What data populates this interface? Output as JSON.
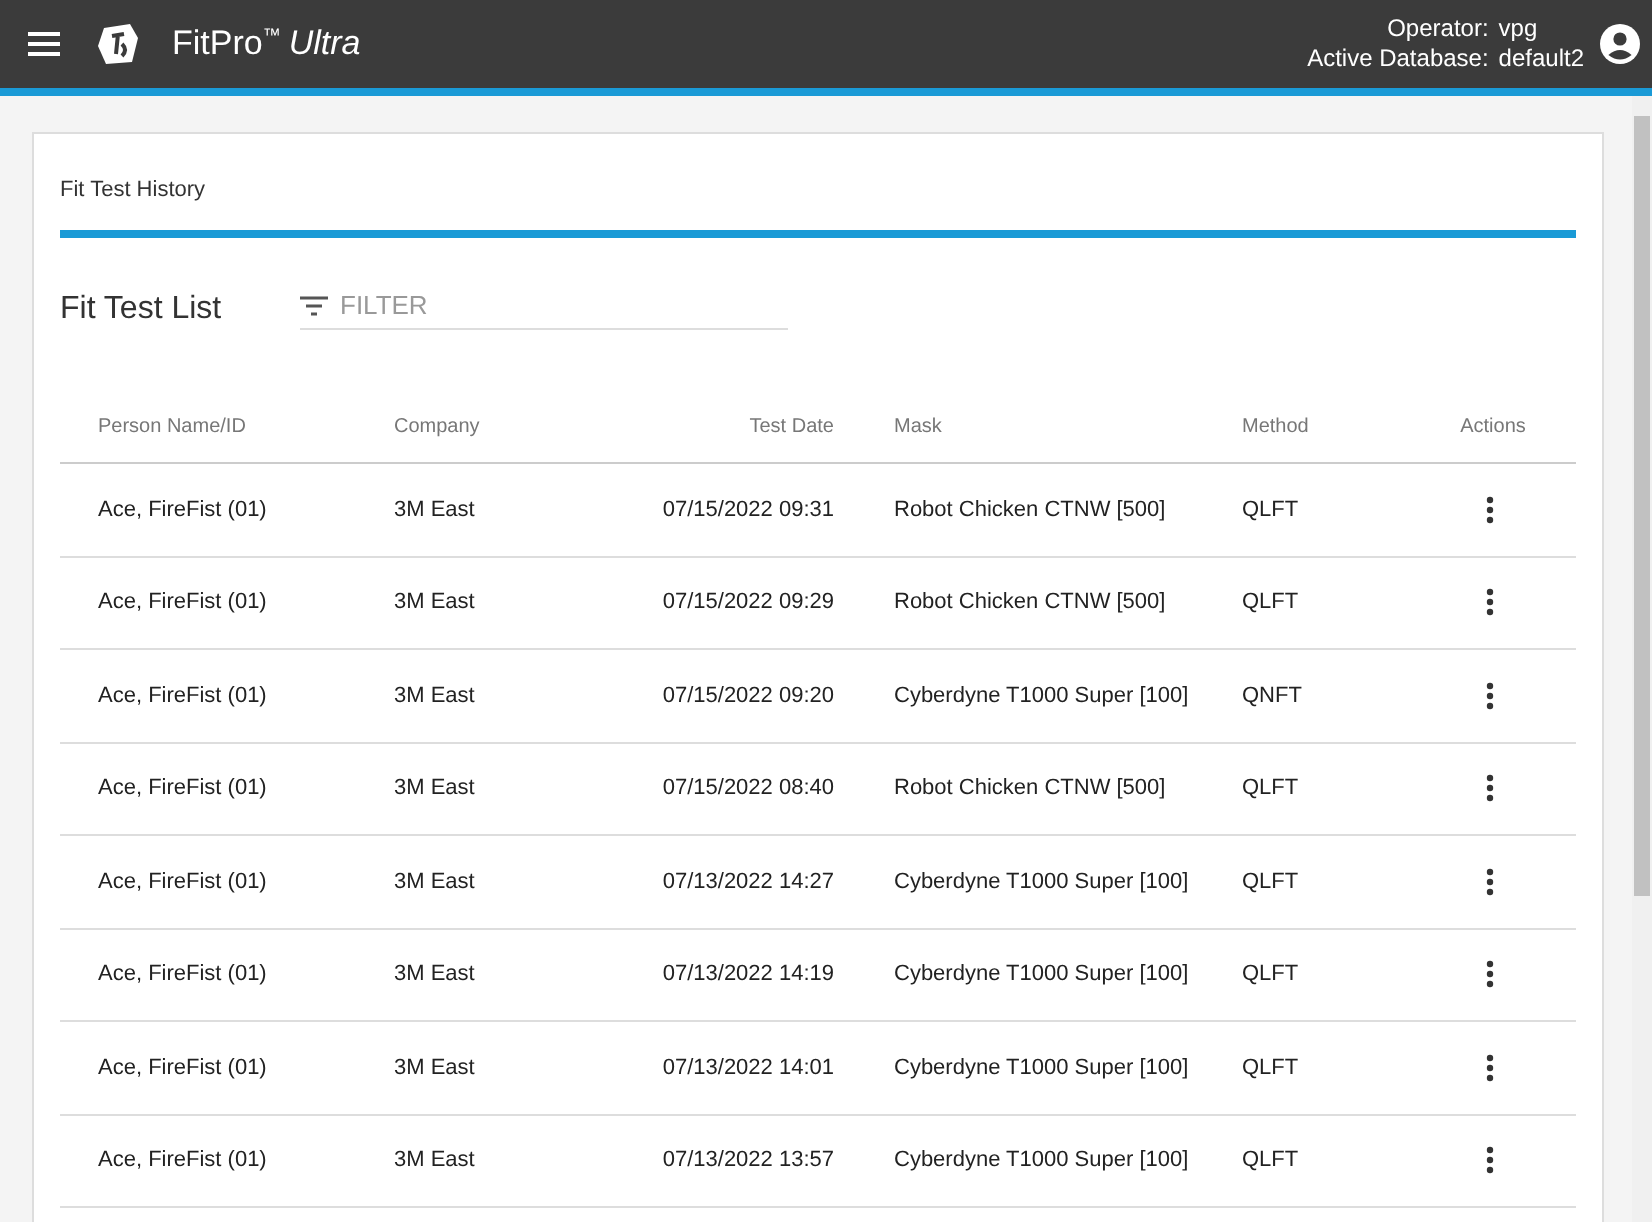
{
  "app_bar": {
    "product": "FitPro",
    "trademark": "™",
    "edition": "Ultra",
    "operator_label": "Operator:",
    "operator": "vpg",
    "database_label": "Active Database:",
    "database": "default2"
  },
  "tabs": [
    {
      "label": "Fit Test History",
      "selected": true
    }
  ],
  "list": {
    "title": "Fit Test List",
    "filter": {
      "placeholder": "FILTER"
    }
  },
  "table": {
    "columns": [
      "Person Name/ID",
      "Company",
      "Test Date",
      "Mask",
      "Method",
      "Actions"
    ],
    "rows": [
      {
        "person": "Ace, FireFist (01)",
        "company": "3M East",
        "date": "07/15/2022 09:31",
        "mask": "Robot Chicken CTNW [500]",
        "method": "QLFT"
      },
      {
        "person": "Ace, FireFist (01)",
        "company": "3M East",
        "date": "07/15/2022 09:29",
        "mask": "Robot Chicken CTNW [500]",
        "method": "QLFT"
      },
      {
        "person": "Ace, FireFist (01)",
        "company": "3M East",
        "date": "07/15/2022 09:20",
        "mask": "Cyberdyne T1000 Super [100]",
        "method": "QNFT"
      },
      {
        "person": "Ace, FireFist (01)",
        "company": "3M East",
        "date": "07/15/2022 08:40",
        "mask": "Robot Chicken CTNW [500]",
        "method": "QLFT"
      },
      {
        "person": "Ace, FireFist (01)",
        "company": "3M East",
        "date": "07/13/2022 14:27",
        "mask": "Cyberdyne T1000 Super [100]",
        "method": "QLFT"
      },
      {
        "person": "Ace, FireFist (01)",
        "company": "3M East",
        "date": "07/13/2022 14:19",
        "mask": "Cyberdyne T1000 Super [100]",
        "method": "QLFT"
      },
      {
        "person": "Ace, FireFist (01)",
        "company": "3M East",
        "date": "07/13/2022 14:01",
        "mask": "Cyberdyne T1000 Super [100]",
        "method": "QLFT"
      },
      {
        "person": "Ace, FireFist (01)",
        "company": "3M East",
        "date": "07/13/2022 13:57",
        "mask": "Cyberdyne T1000 Super [100]",
        "method": "QLFT"
      }
    ]
  }
}
